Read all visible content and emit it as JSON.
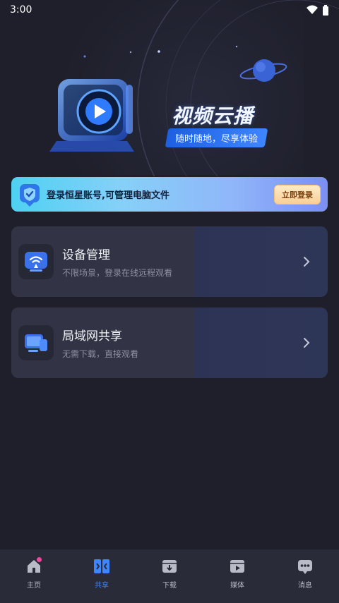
{
  "status_bar": {
    "time": "3:00"
  },
  "hero": {
    "title": "视频云播",
    "subtitle": "随时随地，尽享体验"
  },
  "login_banner": {
    "text": "登录恒星账号,可管理电脑文件",
    "button_label": "立即登录"
  },
  "cards": [
    {
      "title": "设备管理",
      "description": "不限场景，登录在线远程观看",
      "icon": "wifi-device-icon"
    },
    {
      "title": "局域网共享",
      "description": "无需下载，直接观看",
      "icon": "monitor-share-icon"
    }
  ],
  "tabs": [
    {
      "label": "主页",
      "icon": "home-icon",
      "active": false,
      "badge": true
    },
    {
      "label": "共享",
      "icon": "share-icon",
      "active": true,
      "badge": false
    },
    {
      "label": "下载",
      "icon": "download-icon",
      "active": false,
      "badge": false
    },
    {
      "label": "媒体",
      "icon": "media-icon",
      "active": false,
      "badge": false
    },
    {
      "label": "消息",
      "icon": "message-icon",
      "active": false,
      "badge": false
    }
  ],
  "colors": {
    "background": "#1f1f2b",
    "accent": "#3d86ff",
    "badge": "#f0489a",
    "card": "#323446"
  }
}
